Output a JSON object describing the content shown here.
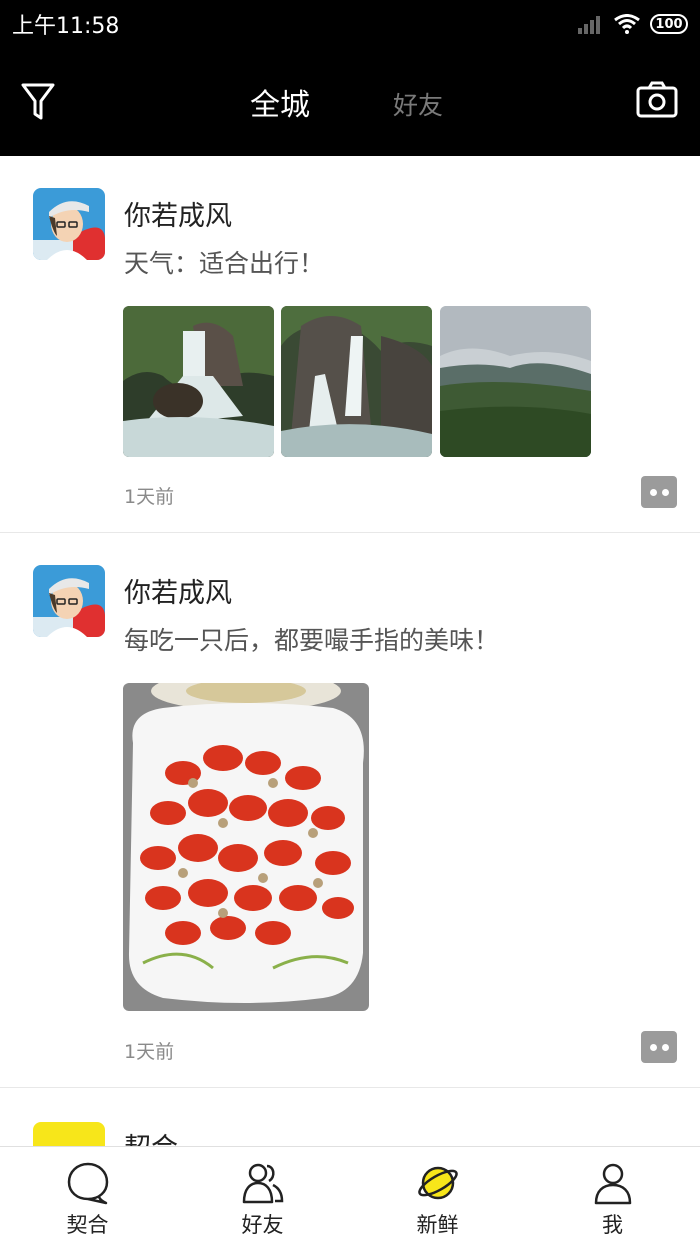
{
  "status": {
    "time": "上午11:58",
    "battery": "100"
  },
  "header": {
    "tab_all": "全城",
    "tab_friends": "好友"
  },
  "posts": [
    {
      "name": "你若成风",
      "content": "天气：适合出行！",
      "time": "1天前"
    },
    {
      "name": "你若成风",
      "content": "每吃一只后，都要嘬手指的美味！",
      "time": "1天前"
    },
    {
      "name": "契合"
    }
  ],
  "nav": [
    {
      "label": "契合",
      "icon": "chat-bubble-icon"
    },
    {
      "label": "好友",
      "icon": "friends-icon"
    },
    {
      "label": "新鲜",
      "icon": "planet-icon",
      "color": "#f7e61a"
    },
    {
      "label": "我",
      "icon": "person-icon"
    }
  ],
  "colors": {
    "accent": "#f7e61a",
    "header_bg": "#000000"
  }
}
